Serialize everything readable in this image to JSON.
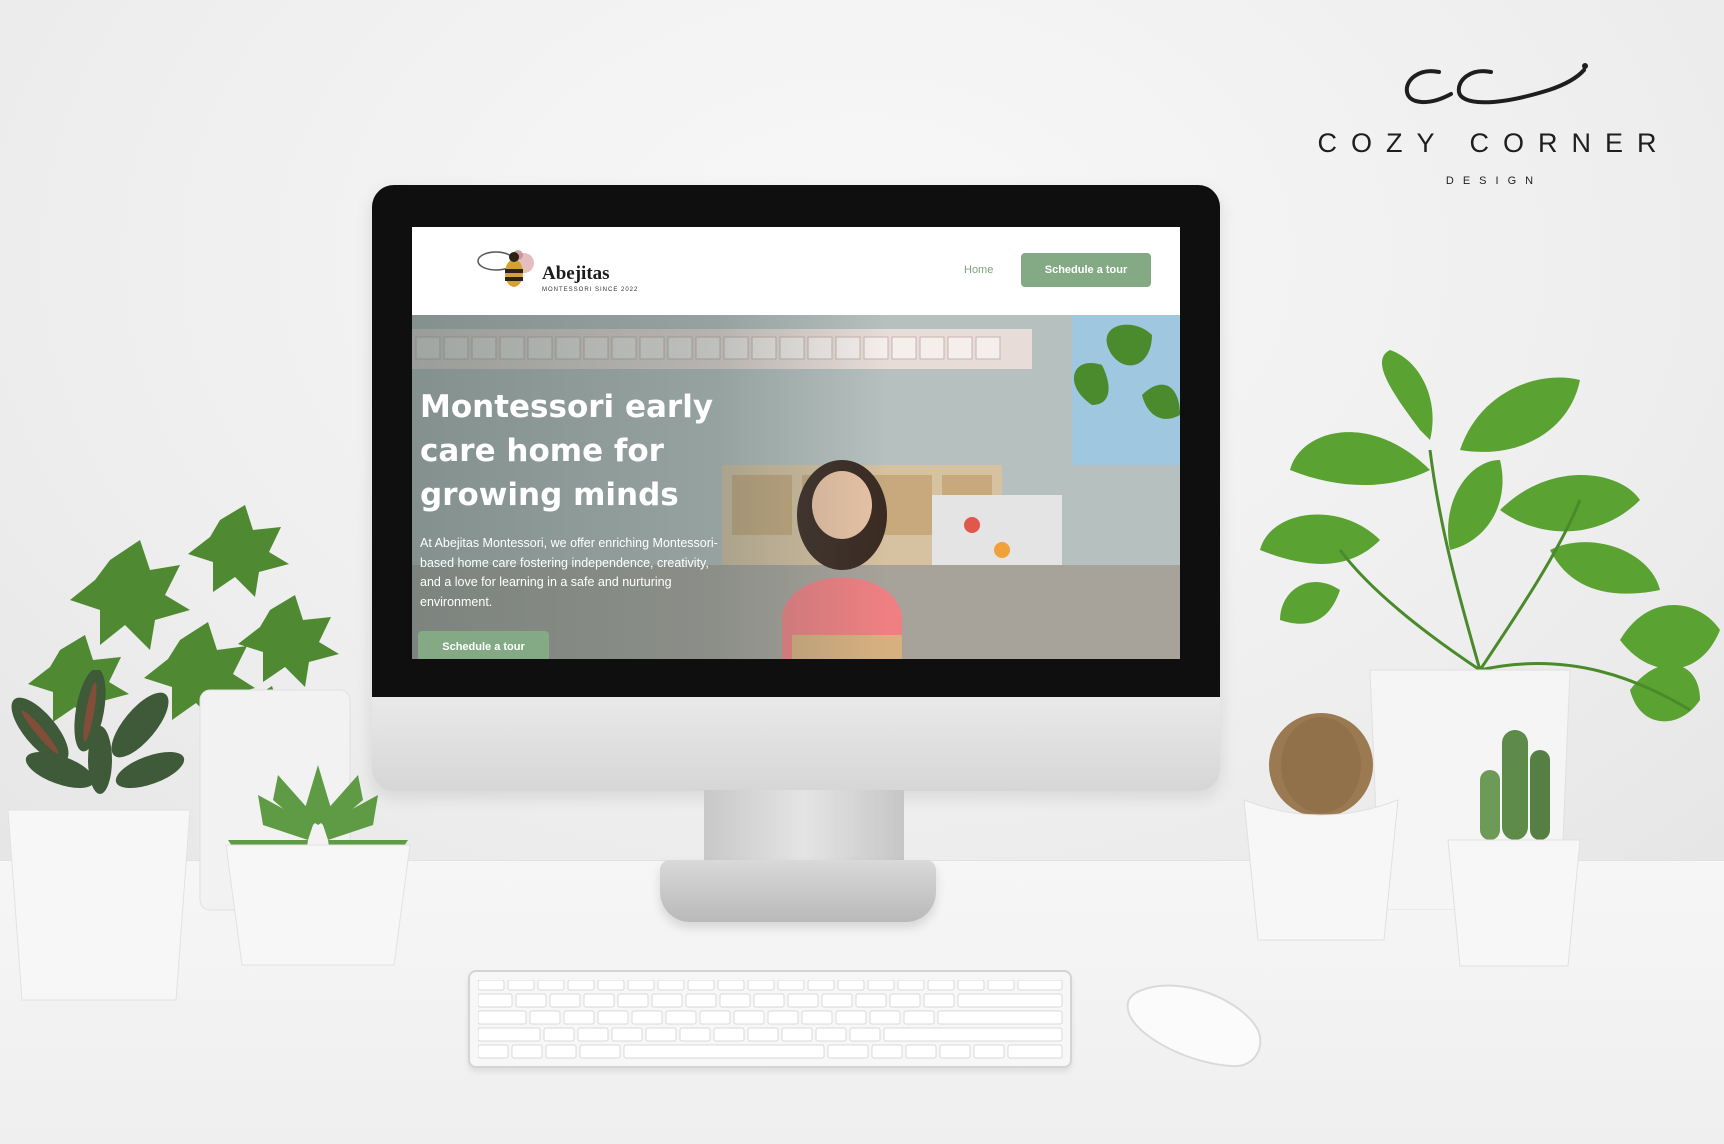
{
  "brand": {
    "name": "COZY CORNER",
    "sub": "DESIGN"
  },
  "site": {
    "logo_name": "Abejitas",
    "logo_tagline": "MONTESSORI SINCE 2022",
    "nav": {
      "home_label": "Home",
      "cta_label": "Schedule a tour"
    },
    "hero": {
      "title": "Montessori early care home for growing minds",
      "text": "At Abejitas Montessori, we offer enriching Montessori-based home care fostering independence, creativity, and a love for learning in a safe and nurturing environment.",
      "cta_label": "Schedule a tour"
    },
    "colors": {
      "accent": "#83aa84",
      "accent_text": "#7da37e"
    }
  }
}
